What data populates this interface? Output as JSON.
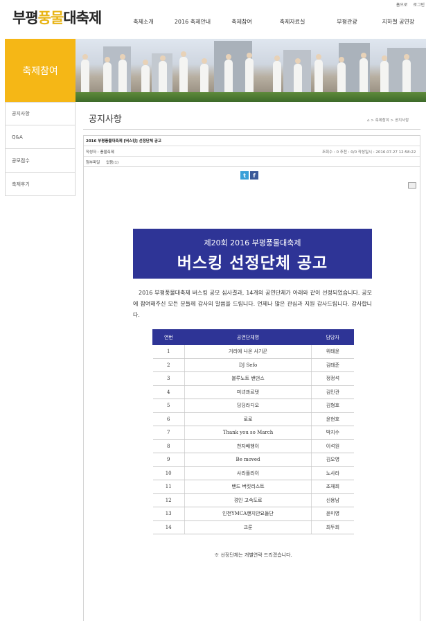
{
  "util_links": [
    "홈으로",
    "로그인"
  ],
  "logo": {
    "part1": "부평",
    "part2": "풍물",
    "part3": "대축제"
  },
  "gnb": [
    "축제소개",
    "2016 축제안내",
    "축제참여",
    "축제자료실",
    "부평관광",
    "지하철 공연장"
  ],
  "section_title": "축제참여",
  "left_menu": [
    "공지사항",
    "Q&A",
    "공모접수",
    "축제후기"
  ],
  "page_title": "공지사항",
  "breadcrumb": "⌂ > 축제참여 > 공지사항",
  "post": {
    "subject": "2016 부평풍물대축제 [버스킹] 선정단체 공고",
    "writer": "작성자 : 풍물축제",
    "meta": "조회수 : 0    추천 : 0/0    작성일시 : 2016.07.27 12:58:22",
    "attach_label": "첨부파일",
    "attach_value": "없음(1)"
  },
  "notice": {
    "sub": "제20회 2016 부평풍물대축제",
    "main": "버스킹 선정단체 공고",
    "body": "2016 부평풍물대축제 버스킹 공모 심사결과, 14개의 공연단체가 아래와 같이 선정되었습니다. 공모에 참여해주신 모든 분들께 감사의 말씀을 드립니다. 언제나 많은 관심과 지원 감사드립니다. 감사합니다."
  },
  "table": {
    "headers": [
      "연번",
      "공연단체명",
      "담당자"
    ],
    "rows": [
      [
        "1",
        "거리에 나온 사기꾼",
        "위태윤"
      ],
      [
        "2",
        "DJ Sefo",
        "김태준"
      ],
      [
        "3",
        "블루노트 밴댄스",
        "정정석"
      ],
      [
        "4",
        "미녀콰르텟",
        "김민관"
      ],
      [
        "5",
        "딩딩라디오",
        "김형호"
      ],
      [
        "6",
        "로로",
        "윤현호"
      ],
      [
        "7",
        "Thank you so March",
        "박지수"
      ],
      [
        "8",
        "천자배행이",
        "이석원"
      ],
      [
        "9",
        "Be moved",
        "김오영"
      ],
      [
        "10",
        "사라플라이",
        "노사라"
      ],
      [
        "11",
        "밴드 버킷리스트",
        "조재희"
      ],
      [
        "12",
        "경인 고속도로",
        "신용남"
      ],
      [
        "13",
        "인천YMCA핸지안요들단",
        "윤미영"
      ],
      [
        "14",
        "크룬",
        "최두희"
      ]
    ]
  },
  "footnote": "※ 선정단체는 개별연락 드리겠습니다.",
  "colors": {
    "accent_yellow": "#f5b716",
    "navy": "#2e3496"
  }
}
